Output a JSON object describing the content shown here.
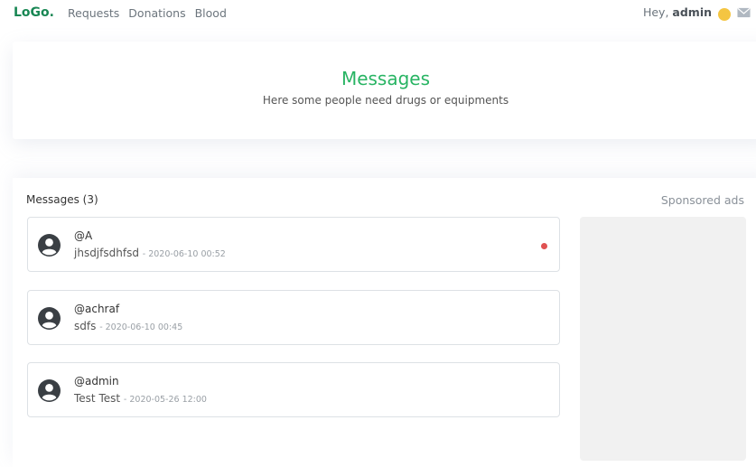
{
  "nav": {
    "logo": "LoGo.",
    "links": [
      "Requests",
      "Donations",
      "Blood"
    ],
    "greeting_prefix": "Hey,",
    "username": "admin",
    "wave_icon": "waving-hand-icon",
    "mail_icon": "envelope-icon"
  },
  "hero": {
    "title": "Messages",
    "subtitle": "Here some people need drugs or equipments"
  },
  "messages_section": {
    "title": "Messages (3)",
    "ads_title": "Sponsored ads",
    "items": [
      {
        "user": "@A",
        "text": "jhsdjfsdhfsd",
        "date": "- 2020-06-10 00:52",
        "unread": true
      },
      {
        "user": "@achraf",
        "text": "sdfs",
        "date": "- 2020-06-10 00:45",
        "unread": false
      },
      {
        "user": "@admin",
        "text": "Test Test",
        "date": "- 2020-05-26 12:00",
        "unread": false
      }
    ]
  },
  "colors": {
    "brand": "#198754",
    "accent": "#28b463",
    "unread": "#e05252"
  }
}
